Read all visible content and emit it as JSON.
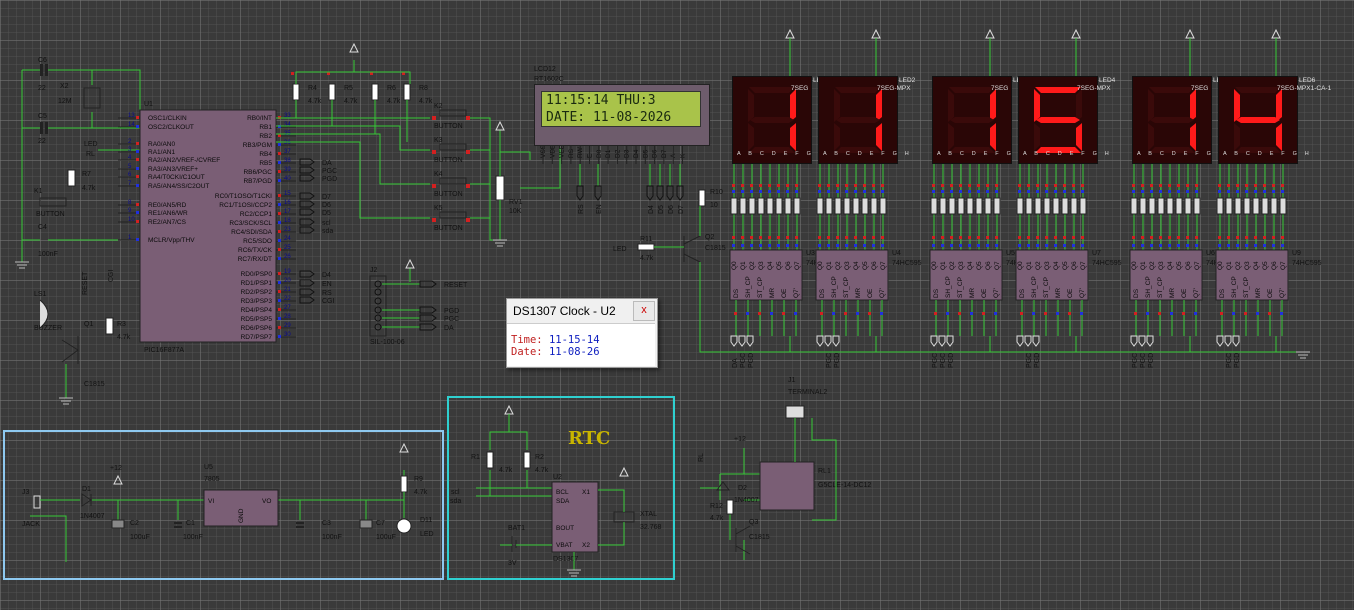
{
  "lcd": {
    "ref": "LCD12",
    "part": "RT1602C",
    "line1": "11:15:14 THU:3",
    "line2": "DATE: 11-08-2026",
    "pins": [
      "VSS",
      "VDD",
      "VEE",
      "RS",
      "RW",
      "E",
      "D0",
      "D1",
      "D2",
      "D3",
      "D4",
      "D5",
      "D6",
      "D7",
      "A",
      "K"
    ]
  },
  "displays": [
    {
      "ref": "LED1",
      "part": "7SEG",
      "digit": "1"
    },
    {
      "ref": "LED2",
      "part": "7SEG-MPX",
      "digit": "1"
    },
    {
      "ref": "LED3",
      "part": "7SEG",
      "digit": "1"
    },
    {
      "ref": "LED4",
      "part": "7SEG-MPX",
      "digit": "5"
    },
    {
      "ref": "LED5",
      "part": "7SEG",
      "digit": "1"
    },
    {
      "ref": "LED6",
      "part": "7SEG-MPX1-CA-1",
      "digit": "4"
    }
  ],
  "seg_pins": "A B C D E F G H",
  "popup": {
    "title": "DS1307 Clock - U2",
    "close": "x",
    "time_label": "Time:",
    "time_value": "11-15-14",
    "date_label": "Date:",
    "date_value": "11-08-26"
  },
  "mcu": {
    "ref": "U1",
    "part": "PIC16F877A",
    "left_pins": [
      "OSC1/CLKIN",
      "OSC2/CLKOUT",
      "RA0/AN0",
      "RA1/AN1",
      "RA2/AN2/VREF-/CVREF",
      "RA3/AN3/VREF+",
      "RA4/T0CKI/C1OUT",
      "RA5/AN4/SS/C2OUT",
      "RE0/AN5/RD",
      "RE1/AN6/WR",
      "RE2/AN7/CS",
      "MCLR/Vpp/THV"
    ],
    "right_pins": [
      "RB0/INT",
      "RB1",
      "RB2",
      "RB3/PGM",
      "RB4",
      "RB5",
      "RB6/PGC",
      "RB7/PGD",
      "RC0/T1OSO/T1CKI",
      "RC1/T1OSI/CCP2",
      "RC2/CCP1",
      "RC3/SCK/SCL",
      "RC4/SDI/SDA",
      "RC5/SDO",
      "RC6/TX/CK",
      "RC7/RX/DT",
      "RD0/PSP0",
      "RD1/PSP1",
      "RD2/PSP2",
      "RD3/PSP3",
      "RD4/PSP4",
      "RD5/PSP5",
      "RD6/PSP6",
      "RD7/PSP7"
    ],
    "right_nums": [
      "33",
      "34",
      "35",
      "36",
      "37",
      "38",
      "39",
      "40",
      "15",
      "16",
      "17",
      "18",
      "23",
      "24",
      "25",
      "26",
      "19",
      "20",
      "21",
      "22",
      "27",
      "28",
      "29",
      "30"
    ],
    "left_nums": [
      "13",
      "14",
      "2",
      "3",
      "4",
      "5",
      "6",
      "7",
      "8",
      "9",
      "10",
      "1"
    ]
  },
  "net_labels_mid": [
    "DA",
    "PGC",
    "PGD",
    "D7",
    "D6",
    "D5",
    "scl",
    "sda",
    "D4",
    "EN",
    "RS",
    "CGI"
  ],
  "osc": {
    "c6": "C6",
    "c6v": "22",
    "c5": "C5",
    "c5v": "22",
    "x2": "X2",
    "x2v": "12M"
  },
  "left_parts": {
    "led": "LED",
    "rl": "RL",
    "r7": "R7",
    "r7v": "4.7k",
    "k1": "K1",
    "button": "BUTTON",
    "c4": "C4",
    "c4v": "100nF",
    "reset": "RESET",
    "cgi": "CGI",
    "ls1": "LS1",
    "buzzer": "BUZZER",
    "q1": "Q1",
    "r3": "R3",
    "r3v": "4.7k",
    "c1815": "C1815"
  },
  "resistors_top": [
    {
      "ref": "R4",
      "val": "4.7k"
    },
    {
      "ref": "R5",
      "val": "4.7k"
    },
    {
      "ref": "R6",
      "val": "4.7k"
    },
    {
      "ref": "R8",
      "val": "4.7k"
    }
  ],
  "buttons": [
    "K2",
    "K3",
    "K4",
    "K5"
  ],
  "button_label": "BUTTON",
  "rv1": {
    "ref": "RV1",
    "val": "10K"
  },
  "r10": {
    "ref": "R10",
    "val": "10"
  },
  "r11": {
    "ref": "R11",
    "val": "4.7k"
  },
  "q2": {
    "ref": "Q2",
    "part": "C1815"
  },
  "led_net": "LED",
  "lcd_nets": [
    "RS",
    "EN",
    "D4",
    "D5",
    "D6",
    "D7"
  ],
  "j2": {
    "ref": "J2",
    "part": "SIL-100-06",
    "nets": [
      "RESET",
      "PGD",
      "PGC",
      "DA"
    ]
  },
  "shift_regs": [
    {
      "ref": "U3",
      "part": "74HC595"
    },
    {
      "ref": "U4",
      "part": "74HC595"
    },
    {
      "ref": "U5",
      "part": "74HC595"
    },
    {
      "ref": "U7",
      "part": "74HC595"
    },
    {
      "ref": "U6",
      "part": "74HC595"
    },
    {
      "ref": "U9",
      "part": "74HC595"
    }
  ],
  "sr_pins": [
    "DS",
    "SH_CP",
    "ST_CP",
    "MR",
    "OE",
    "Q7'"
  ],
  "sr_outputs": [
    "Q0",
    "Q1",
    "Q2",
    "Q3",
    "Q4",
    "Q5",
    "Q6",
    "Q7"
  ],
  "sr_bottom_nets": [
    "DA",
    "PGC",
    "PGD"
  ],
  "power": {
    "j3": "J3",
    "jack": "JACK",
    "d1": "D1",
    "d1p": "1N4007",
    "plus12": "+12",
    "u5": "U5",
    "u5p": "7805",
    "vi": "VI",
    "vo": "VO",
    "gnd": "GND",
    "c2": "C2",
    "c2v": "100uF",
    "c1": "C1",
    "c1v": "100nF",
    "c3": "C3",
    "c3v": "100nF",
    "c7": "C7",
    "c7v": "100uF",
    "r9": "R9",
    "r9v": "4.7k",
    "d11": "D11",
    "d11p": "LED"
  },
  "rtc": {
    "title": "RTC",
    "r1": "R1",
    "r1v": "4.7k",
    "r2": "R2",
    "r2v": "4.7k",
    "u2": "U2",
    "u2p": "DS1307",
    "bcl": "BCL",
    "sda": "SDA",
    "bout": "BOUT",
    "vbat": "VBAT",
    "x1": "X1",
    "x2": "X2",
    "xtal": "XTAL",
    "xtalv": "32.768",
    "bat1": "BAT1",
    "batv": "3V",
    "scl": "scl",
    "sdanet": "sda"
  },
  "relay": {
    "j1": "J1",
    "terminal": "TERMINAL2",
    "plus12": "+12",
    "rl": "RL",
    "d2": "D2",
    "d2p": "1N4007",
    "r12": "R12",
    "r12v": "4.7k",
    "q3": "Q3",
    "q3p": "C1815",
    "rl1": "RL1",
    "rl1p": "G5CLE-14-DC12"
  },
  "colors": {
    "wire": "#36c936",
    "chip": "#7a5e75",
    "seg_on": "#ff1a1a",
    "seg_off": "#3a0a0a",
    "lcd_bg": "#a9c34a",
    "rtc_box": "#2fd0d0",
    "power_box": "#8ec9f0"
  }
}
